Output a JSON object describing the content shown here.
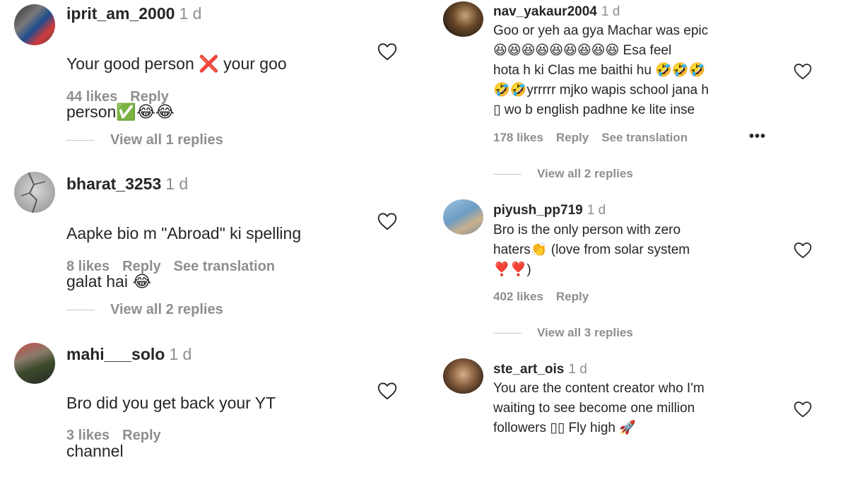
{
  "left_comments": [
    {
      "username": "iprit_am_2000",
      "time": "1 d",
      "text_line1": "Your good person ❌ your goo",
      "text_line2": "person✅😂😂",
      "likes": "44 likes",
      "reply": "Reply",
      "view_replies": "View all 1 replies"
    },
    {
      "username": "bharat_3253",
      "time": "1 d",
      "text_line1": "Aapke bio m \"Abroad\" ki spelling",
      "text_line2": "galat hai 😂",
      "likes": "8 likes",
      "reply": "Reply",
      "translation": "See translation",
      "view_replies": "View all 2 replies"
    },
    {
      "username": "mahi___solo",
      "time": "1 d",
      "text_line1": "Bro did you get back your YT",
      "text_line2": "channel",
      "likes": "3 likes",
      "reply": "Reply"
    }
  ],
  "right_comments": [
    {
      "username": "nav_yakaur2004",
      "time": "1 d",
      "text": "Goo or yeh aa gya Machar was epic\n😆😆😆😆😆😆😆😆😆 Esa feel\nhota h ki Clas me baithi hu 🤣🤣🤣\n🤣🤣yrrrrr mjko wapis school jana h\n▯ wo b english padhne ke lite inse",
      "likes": "178 likes",
      "reply": "Reply",
      "translation": "See translation",
      "more": "•••",
      "view_replies": "View all 2 replies"
    },
    {
      "username": "piyush_pp719",
      "time": "1 d",
      "text": "Bro is the only person with zero\nhaters👏 (love from solar system\n❣️❣️)",
      "likes": "402 likes",
      "reply": "Reply",
      "view_replies": "View all 3 replies"
    },
    {
      "username": "ste_art_ois",
      "time": "1 d",
      "text": "You are the content creator who I'm\nwaiting to see become one million\nfollowers ▯▯ Fly high 🚀"
    }
  ],
  "colors": {
    "primary_text": "#262626",
    "secondary_text": "#8e8e8e",
    "divider": "#c7c7c7"
  },
  "icons": {
    "like": "heart-outline-icon",
    "more": "more-horizontal-icon"
  }
}
